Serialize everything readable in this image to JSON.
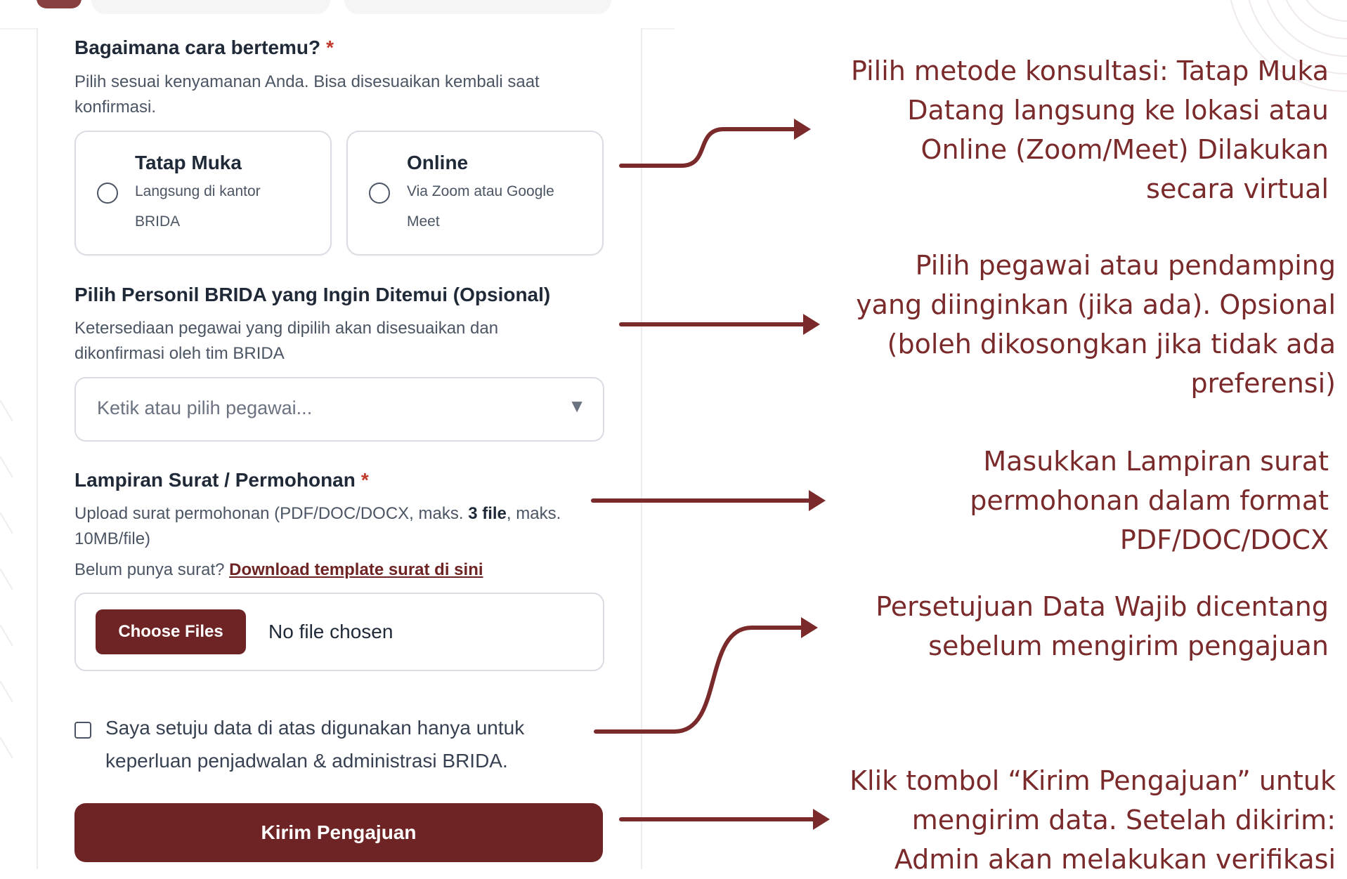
{
  "meeting": {
    "title": "Bagaimana cara bertemu?",
    "required_mark": "*",
    "help": "Pilih sesuai kenyamanan Anda. Bisa disesuaikan kembali saat konfirmasi.",
    "options": [
      {
        "title": "Tatap Muka",
        "desc": "Langsung di kantor BRIDA"
      },
      {
        "title": "Online",
        "desc": "Via Zoom atau Google Meet"
      }
    ]
  },
  "personnel": {
    "title": "Pilih Personil BRIDA yang Ingin Ditemui (Opsional)",
    "help": "Ketersediaan pegawai yang dipilih akan disesuaikan dan dikonfirmasi oleh tim BRIDA",
    "placeholder": "Ketik atau pilih pegawai...",
    "caret": "▼"
  },
  "attachment": {
    "title": "Lampiran Surat / Permohonan",
    "required_mark": "*",
    "help_prefix": "Upload surat permohonan (PDF/DOC/DOCX, maks. ",
    "help_bold": "3 file",
    "help_suffix": ", maks. 10MB/file)",
    "template_prefix": "Belum punya surat?",
    "template_link": "Download template surat di sini",
    "choose_label": "Choose Files",
    "no_file": "No file chosen"
  },
  "consent": {
    "text": "Saya setuju data di atas digunakan hanya untuk keperluan penjadwalan & administrasi BRIDA."
  },
  "submit": {
    "label": "Kirim Pengajuan"
  },
  "annotations": [
    {
      "lines": [
        "Pilih metode konsultasi: Tatap Muka",
        "Datang langsung ke lokasi atau",
        "Online (Zoom/Meet) Dilakukan",
        "secara virtual"
      ]
    },
    {
      "lines": [
        "Pilih pegawai atau pendamping",
        "yang diinginkan (jika ada). Opsional",
        "(boleh dikosongkan jika tidak ada",
        "preferensi)"
      ]
    },
    {
      "lines": [
        "Masukkan Lampiran surat",
        "permohonan dalam format",
        "PDF/DOC/DOCX"
      ]
    },
    {
      "lines": [
        "Persetujuan Data Wajib dicentang",
        "sebelum mengirim pengajuan"
      ]
    },
    {
      "lines": [
        "Klik tombol “Kirim Pengajuan” untuk",
        "mengirim data. Setelah dikirim:",
        "Admin akan melakukan verifikasi"
      ]
    }
  ],
  "colors": {
    "brand": "#6e2424",
    "annotation": "#7a2a2a",
    "required": "#c0392b"
  }
}
